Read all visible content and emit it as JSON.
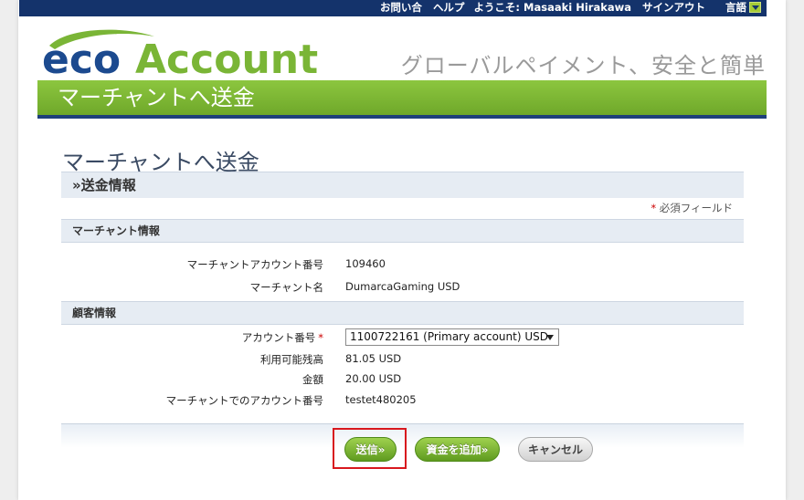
{
  "topbar": {
    "contact": "お問い合",
    "help": "ヘルプ",
    "greeting": "ようこそ: Masaaki Hirakawa",
    "signout": "サインアウト",
    "language": "言語"
  },
  "brand": {
    "logo_eco": "eco",
    "logo_account": "Account",
    "tagline": "グローバルペイメント、安全と簡単",
    "banner_title": "マーチャントへ送金",
    "colors": {
      "navy": "#14336b",
      "green": "#7ab536",
      "logo_blue": "#1c4a8f"
    }
  },
  "main": {
    "page_title": "マーチャントへ送金",
    "section_title": "»送金情報",
    "required_note": "必須フィールド",
    "required_star": "*",
    "merchant_info": {
      "header": "マーチャント情報",
      "account_number_label": "マーチャントアカウント番号",
      "account_number_value": "109460",
      "name_label": "マーチャント名",
      "name_value": "DumarcaGaming USD"
    },
    "customer_info": {
      "header": "顧客情報",
      "account_label": "アカウント番号",
      "account_selected": "1100722161 (Primary account) USD",
      "balance_label": "利用可能残高",
      "balance_value": "81.05 USD",
      "amount_label": "金額",
      "amount_value": "20.00 USD",
      "merchant_account_label": "マーチャントでのアカウント番号",
      "merchant_account_value": "testet480205"
    },
    "buttons": {
      "send": "送信»",
      "add_funds": "資金を追加»",
      "cancel": "キャンセル"
    }
  }
}
